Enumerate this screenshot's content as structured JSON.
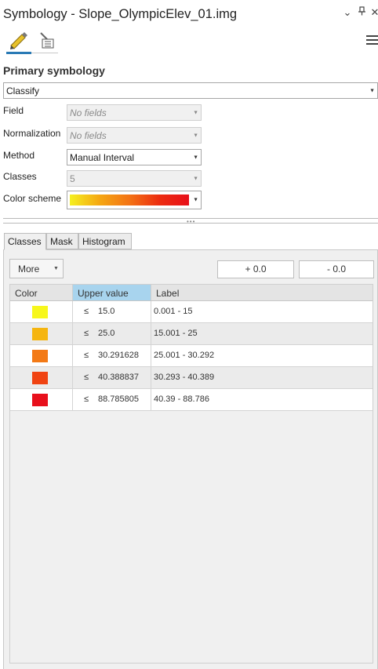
{
  "window": {
    "title": "Symbology - Slope_OlympicElev_01.img",
    "controls": [
      "⌄",
      "📌",
      "✕"
    ]
  },
  "section": {
    "title": "Primary symbology"
  },
  "renderer": {
    "value": "Classify"
  },
  "fields": {
    "field": {
      "label": "Field",
      "value": "No fields"
    },
    "normalization": {
      "label": "Normalization",
      "value": "No fields"
    },
    "method": {
      "label": "Method",
      "value": "Manual Interval"
    },
    "classes": {
      "label": "Classes",
      "value": "5"
    },
    "color_scheme": {
      "label": "Color scheme"
    }
  },
  "colors": {
    "accent": "#2a7ab5",
    "ramp": [
      "#f5f020",
      "#f5a712",
      "#f37315",
      "#ec2d10",
      "#e8101a"
    ]
  },
  "tabs": [
    {
      "label": "Classes",
      "active": true
    },
    {
      "label": "Mask",
      "active": false
    },
    {
      "label": "Histogram",
      "active": false
    }
  ],
  "toolbar": {
    "more_label": "More",
    "plus_label": "+ 0.0",
    "minus_label": "- 0.0"
  },
  "table": {
    "headers": [
      "Color",
      "Upper value",
      "Label"
    ],
    "rows": [
      {
        "color": "#f7f71c",
        "le": "≤",
        "upper": "15.0",
        "label": "0.001 - 15"
      },
      {
        "color": "#f5b510",
        "le": "≤",
        "upper": "25.0",
        "label": "15.001 - 25"
      },
      {
        "color": "#f37a16",
        "le": "≤",
        "upper": "30.291628",
        "label": "25.001 - 30.292"
      },
      {
        "color": "#f04312",
        "le": "≤",
        "upper": "40.388837",
        "label": "30.293 - 40.389"
      },
      {
        "color": "#e8101c",
        "le": "≤",
        "upper": "88.785805",
        "label": "40.39 - 88.786"
      }
    ]
  }
}
